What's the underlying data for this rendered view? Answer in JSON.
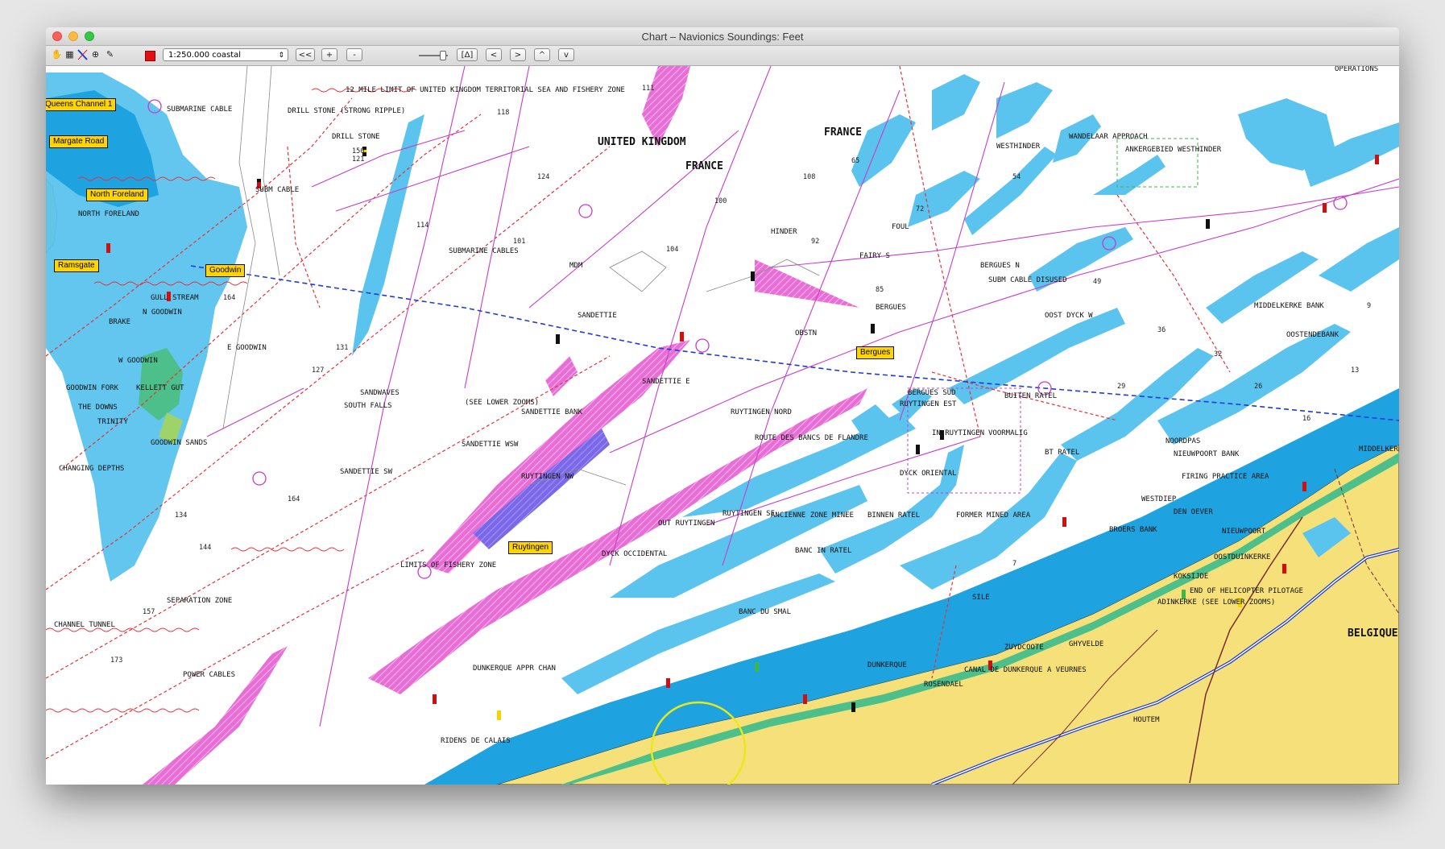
{
  "window": {
    "title": "Chart – Navionics  Soundings: Feet"
  },
  "toolbar": {
    "scale_value": "1:250.000 coastal",
    "buttons": [
      "<<",
      "+",
      "-",
      "[Δ]",
      "<",
      ">",
      "^",
      "v"
    ]
  },
  "map": {
    "place_tags": [
      "Queens Channel 1",
      "Margate Road",
      "North Foreland",
      "Ramsgate",
      "Goodwin",
      "Bergues",
      "Ruytingen"
    ],
    "region_labels": [
      "UNITED KINGDOM",
      "FRANCE",
      "FRANCE",
      "BELGIQUE"
    ],
    "feature_labels": [
      "12 MILE LIMIT OF UNITED KINGDOM TERRITORIAL SEA AND FISHERY ZONE",
      "DRILL STONE (STRONG RIPPLE)",
      "DRILL STONE",
      "SUBMARINE CABLE",
      "SUBM CABLE",
      "NORTH FORELAND",
      "GULL STREAM",
      "BRAKE",
      "N GOODWIN",
      "E GOODWIN",
      "W GOODWIN",
      "GOODWIN FORK",
      "KELLETT GUT",
      "THE DOWNS",
      "TRINITY",
      "GOODWIN SANDS",
      "CHANGING DEPTHS",
      "SOUTH FALLS",
      "SANDWAVES",
      "SANDETTIE",
      "SANDETTIE BANK",
      "SANDETTIE WSW",
      "SANDETTIE E",
      "SANDETTIE SW",
      "RUYTINGEN NORD",
      "RUYTINGEN NW",
      "RUYTINGEN SE",
      "RUYTINGEN EST",
      "IN RUYTINGEN",
      "OUT RUYTINGEN",
      "ROUTE DES BANCS DE FLANDRE",
      "ANCIENNE ZONE MINEE",
      "BINNEN RATEL",
      "BANC IN RATEL",
      "BT RATEL",
      "BUITEN RATEL",
      "VOORMALIG",
      "FORMER MINED AREA",
      "NOORDPAS",
      "NIEUWPOORT BANK",
      "FIRING PRACTICE AREA",
      "WESTDIEP",
      "DEN OEVER",
      "BROERS BANK",
      "NIEUWPOORT",
      "OOSTDUINKERKE",
      "KOKSIJDE",
      "ADINKERKE (SEE LOWER ZOOMS)",
      "END OF HELICOPTER PILOTAGE",
      "MIDDELKERKE BANK",
      "OOSTENDEBANK",
      "OOST DYCK W",
      "WESTHINDER",
      "ANKERGEBIED WESTHINDER",
      "WANDELAAR APPROACH",
      "HINDER",
      "FAIRY S",
      "FOUL",
      "BERGUES",
      "BERGUES SUD",
      "BERGUES N",
      "SUBM CABLE DISUSED",
      "DYCK OCCIDENTAL",
      "DYCK ORIENTAL",
      "DUNKERQUE",
      "DUNKERQUE APPR CHAN",
      "CANAL DE DUNKERQUE A VEURNES",
      "ROSENDAEL",
      "ZUYDCOOTE",
      "GHYVELDE",
      "HOUTEM",
      "LIMITS OF FISHERY ZONE",
      "SEPARATION ZONE",
      "CHANNEL TUNNEL",
      "POWER CABLES",
      "RIDENS DE CALAIS",
      "OBSTN",
      "OPERATIONS",
      "SUBMARINE CABLES",
      "(SEE LOWER ZOOMS)",
      "MIDDELKERKE",
      "SILE",
      "BANC DU SMAL",
      "MDM"
    ],
    "soundings": [
      "121",
      "118",
      "124",
      "114",
      "100",
      "108",
      "164",
      "127",
      "131",
      "164",
      "150",
      "92",
      "85",
      "72",
      "65",
      "54",
      "49",
      "36",
      "32",
      "29",
      "26",
      "16",
      "13",
      "9",
      "7",
      "101",
      "104",
      "111",
      "134",
      "144",
      "157",
      "173"
    ]
  },
  "colors": {
    "land": "#f5e07a",
    "shallow": "#5ac3ee",
    "very_shallow": "#1ea3e0",
    "traffic_zone": "#e87ad8",
    "magenta": "#d400d4",
    "limit_line": "#e8303a",
    "cable_line": "#c83cc8",
    "tag_fill": "#ffd400",
    "window_chrome": "#d8d8d8"
  },
  "icons": [
    "hand-icon",
    "select-icon",
    "measure-icon",
    "crosshair-icon",
    "pencil-icon",
    "stop-icon",
    "chevron-down-icon",
    "buoy-icon",
    "lighthouse-icon",
    "wreck-icon",
    "anchor-icon",
    "church-icon"
  ]
}
